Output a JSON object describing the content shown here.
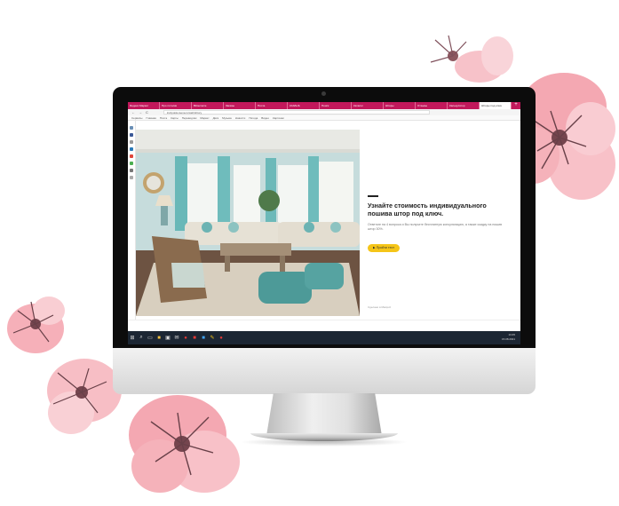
{
  "browser": {
    "tabs": [
      {
        "label": "Яндекс-Маркет"
      },
      {
        "label": "Про потолки"
      },
      {
        "label": "ВКонтакте"
      },
      {
        "label": "Заказы"
      },
      {
        "label": "Почта"
      },
      {
        "label": "КАЗАНЬ"
      },
      {
        "label": "Поиск"
      },
      {
        "label": "Каталог"
      },
      {
        "label": "Шторы"
      },
      {
        "label": "Отзывы"
      },
      {
        "label": "Калькулятор"
      },
      {
        "label": "Шторы под ключ",
        "active": true
      }
    ],
    "nav_back": "←",
    "nav_forward": "→",
    "nav_reload": "C",
    "url": "kvizpoisk-tsena.ru/calc/shtory",
    "bookmarks": [
      "Сервисы",
      "Главная",
      "Почта",
      "Карты",
      "Переводчик",
      "Маркет",
      "Диск",
      "Музыка",
      "Новости",
      "Погода",
      "Видео",
      "Картинки"
    ]
  },
  "page": {
    "headline": "Узнайте стоимость индивидуального пошива штор под ключ.",
    "subtext": "Ответьте на 4 вопроса и Вы получите бесплатную консультацию, а также скидку на пошив штор 30%.",
    "cta_label": "Пройти тест",
    "cta_icon": "play-icon",
    "footnote": "Сделано в Marquiz"
  },
  "taskbar": {
    "start_icon": "windows-start-icon",
    "time": "13:45",
    "date": "15.08.2021"
  },
  "colors": {
    "tab_bar": "#c2185b",
    "cta": "#f5c518",
    "taskbar": "#1c2633",
    "flower_pink": "#f08c98"
  }
}
